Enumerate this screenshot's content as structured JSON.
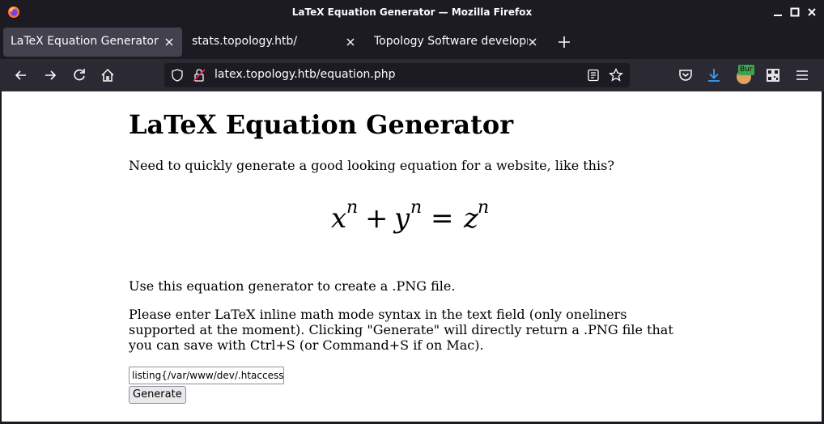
{
  "window": {
    "title": "LaTeX Equation Generator — Mozilla Firefox"
  },
  "tabs": [
    {
      "label": "LaTeX Equation Generator",
      "active": true
    },
    {
      "label": "stats.topology.htb/",
      "active": false
    },
    {
      "label": "Topology Software developm",
      "active": false
    }
  ],
  "navbar": {
    "url": "latex.topology.htb/equation.php",
    "extension_badge": "Bur"
  },
  "page": {
    "heading": "LaTeX Equation Generator",
    "intro": "Need to quickly generate a good looking equation for a website, like this?",
    "equation": {
      "x": "x",
      "y": "y",
      "z": "z",
      "exp": "n",
      "plus": "+",
      "equals": "="
    },
    "usage": "Use this equation generator to create a .PNG file.",
    "instructions": "Please enter LaTeX inline math mode syntax in the text field (only oneliners supported at the moment). Clicking \"Generate\" will directly return a .PNG file that you can save with Ctrl+S (or Command+S if on Mac).",
    "input_value": "\\lstinputlisting{/var/www/dev/.htaccess}",
    "input_visible": "listing{/var/www/dev/.htaccess",
    "button_label": "Generate"
  },
  "colors": {
    "chrome_dark": "#1c1b22",
    "navbar": "#2b2a33",
    "active_tab": "#42414d",
    "text_light": "#fbfbfe",
    "download_accent": "#3d9cf5"
  }
}
